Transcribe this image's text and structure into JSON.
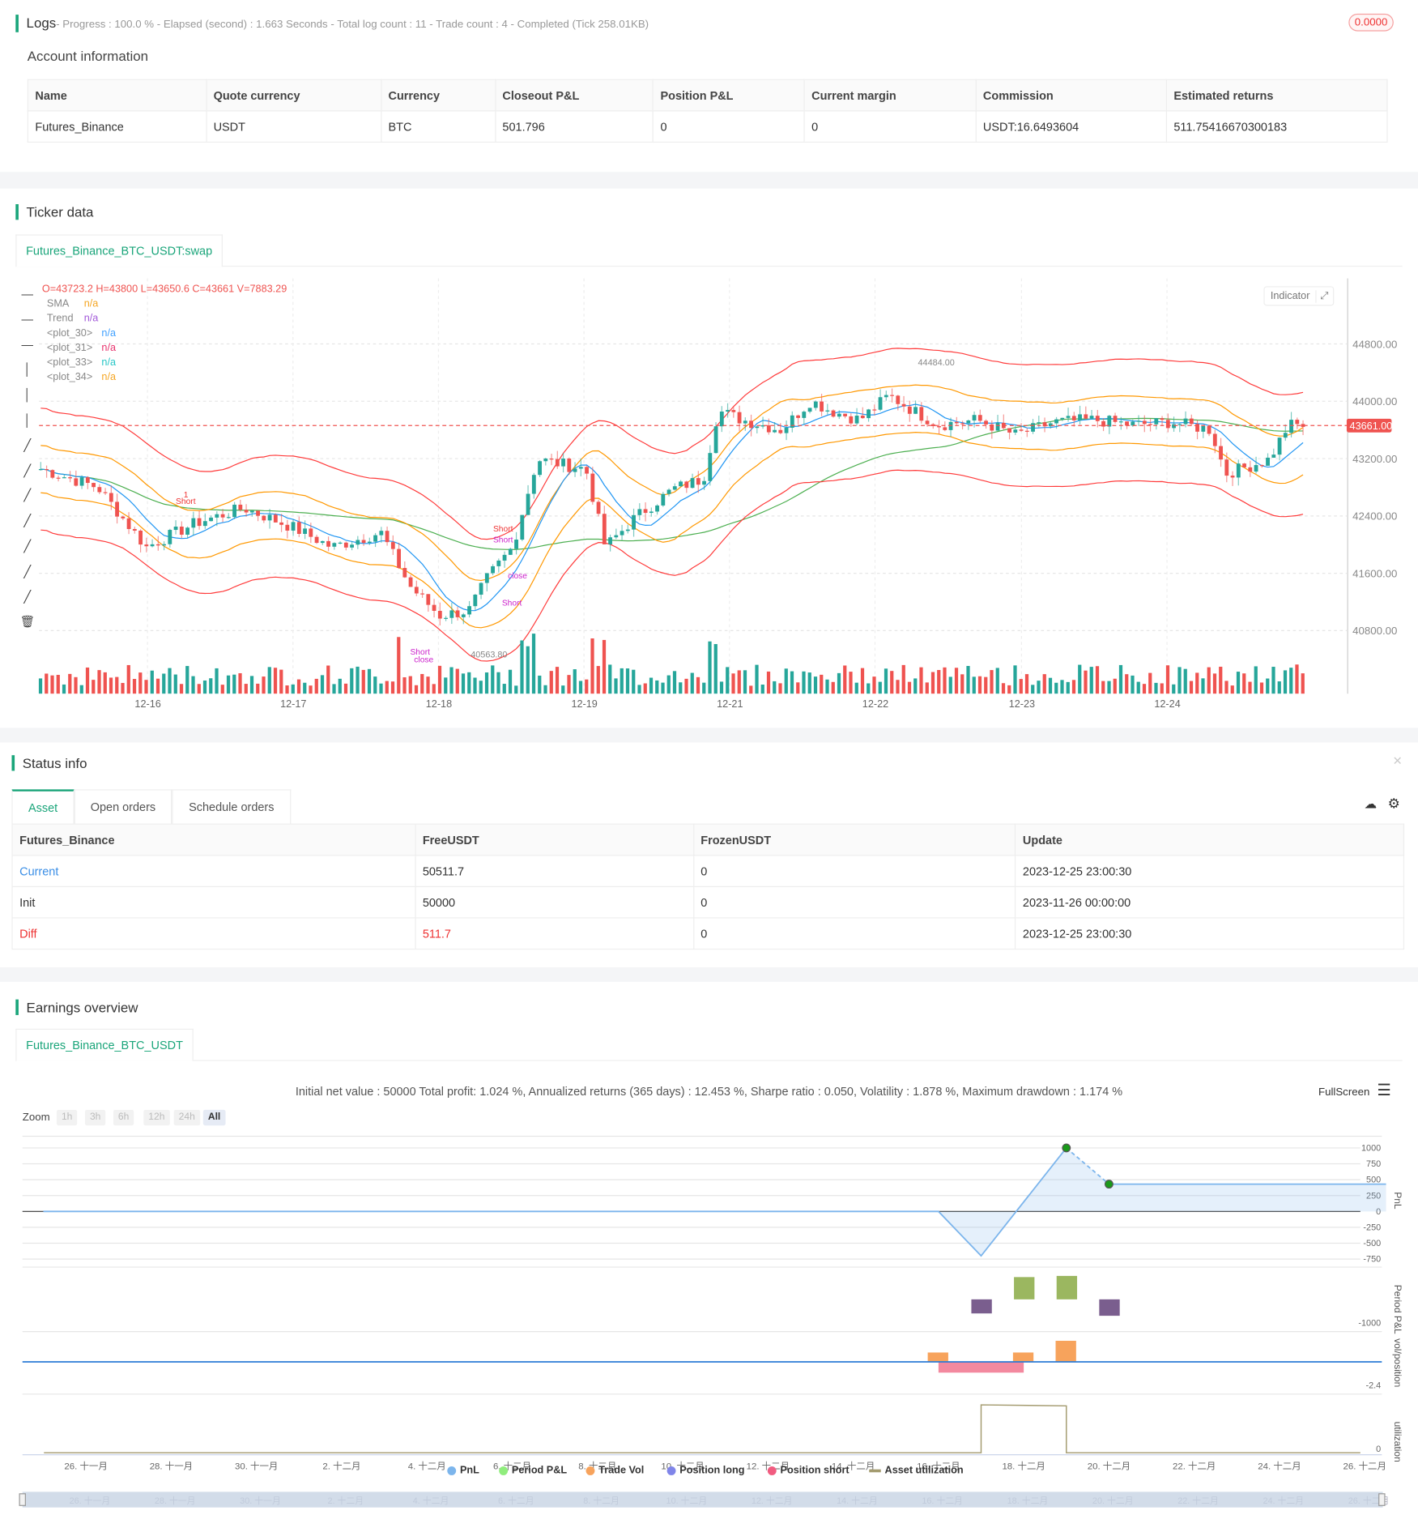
{
  "logs": {
    "title": "Logs",
    "summary": "- Progress : 100.0 % - Elapsed (second) : 1.663  Seconds - Total log count : 11 - Trade count : 4 - Completed (Tick 258.01KB)",
    "badge": "0.0000"
  },
  "account": {
    "title": "Account information",
    "headers": [
      "Name",
      "Quote currency",
      "Currency",
      "Closeout P&L",
      "Position P&L",
      "Current margin",
      "Commission",
      "Estimated returns"
    ],
    "row": [
      "Futures_Binance",
      "USDT",
      "BTC",
      "501.796",
      "0",
      "0",
      "USDT:16.6493604",
      "511.75416670300183"
    ]
  },
  "ticker": {
    "title": "Ticker data",
    "tab": "Futures_Binance_BTC_USDT:swap",
    "ohlc": "O=43723.2 H=43800 L=43650.6 C=43661 V=7883.29",
    "legend": [
      {
        "name": "SMA",
        "val": "n/a",
        "color": "#f5a623"
      },
      {
        "name": "Trend",
        "val": "n/a",
        "color": "#a259d9"
      },
      {
        "name": "<plot_30>",
        "val": "n/a",
        "color": "#3fa0ff"
      },
      {
        "name": "<plot_31>",
        "val": "n/a",
        "color": "#e8336d"
      },
      {
        "name": "<plot_33>",
        "val": "n/a",
        "color": "#26c6c6"
      },
      {
        "name": "<plot_34>",
        "val": "n/a",
        "color": "#f5a623"
      }
    ],
    "indicator_label": "Indicator",
    "last_price": "43661.00",
    "high_label": "44484.00",
    "low_label": "40563.80",
    "y_ticks": [
      "44800.00",
      "44000.00",
      "43200.00",
      "42400.00",
      "41600.00",
      "40800.00"
    ],
    "y_values": [
      44800,
      44000,
      43200,
      42400,
      41600,
      40800
    ],
    "x_ticks": [
      "12-16",
      "12-17",
      "12-18",
      "12-19",
      "12-21",
      "12-22",
      "12-23",
      "12-24"
    ],
    "markers": [
      "Short",
      "1",
      "Short",
      "close",
      "Short",
      "Short",
      "close",
      "Short"
    ],
    "price_anchors": [
      [
        6.4,
        43055
      ],
      [
        15.8,
        42800
      ],
      [
        23.8,
        41965
      ],
      [
        31.9,
        42300
      ],
      [
        39.9,
        42510
      ],
      [
        48,
        42240
      ],
      [
        54.4,
        41965
      ],
      [
        62.5,
        42170
      ],
      [
        67.3,
        41420
      ],
      [
        72.2,
        41010
      ],
      [
        77,
        41080
      ],
      [
        80.2,
        41555
      ],
      [
        84.2,
        41965
      ],
      [
        88.3,
        43190
      ],
      [
        96.3,
        43055
      ],
      [
        99.5,
        41965
      ],
      [
        104.4,
        42375
      ],
      [
        110.8,
        42780
      ],
      [
        115.7,
        42920
      ],
      [
        118.1,
        43870
      ],
      [
        122.1,
        43740
      ],
      [
        128.6,
        43600
      ],
      [
        133.4,
        44010
      ],
      [
        136.6,
        43870
      ],
      [
        141.5,
        43740
      ],
      [
        146.3,
        44080
      ],
      [
        150.3,
        43870
      ],
      [
        154.4,
        43670
      ],
      [
        160.8,
        43740
      ],
      [
        167.2,
        43530
      ],
      [
        173.6,
        43710
      ],
      [
        180.1,
        43740
      ],
      [
        186.5,
        43670
      ],
      [
        192.9,
        43710
      ],
      [
        199.4,
        43600
      ],
      [
        201.8,
        42990
      ],
      [
        204.2,
        43055
      ],
      [
        209,
        43190
      ],
      [
        212.2,
        43670
      ],
      [
        214.6,
        43661
      ]
    ]
  },
  "status": {
    "title": "Status info",
    "tabs": [
      "Asset",
      "Open orders",
      "Schedule orders"
    ],
    "headers": [
      "Futures_Binance",
      "FreeUSDT",
      "FrozenUSDT",
      "Update"
    ],
    "rows": [
      [
        "Current",
        "50511.7",
        "0",
        "2023-12-25 23:00:30"
      ],
      [
        "Init",
        "50000",
        "0",
        "2023-11-26 00:00:00"
      ],
      [
        "Diff",
        "511.7",
        "0",
        "2023-12-25 23:00:30"
      ]
    ]
  },
  "earnings": {
    "title": "Earnings overview",
    "tab": "Futures_Binance_BTC_USDT",
    "summary": "Initial net value : 50000 Total profit: 1.024 %, Annualized returns (365 days) : 12.453 %, Sharpe ratio : 0.050, Volatility : 1.878 %, Maximum drawdown : 1.174 %",
    "fullscreen": "FullScreen",
    "zoom_label": "Zoom",
    "zoom_options": [
      "1h",
      "3h",
      "6h",
      "12h",
      "24h",
      "All"
    ],
    "pnl_ticks": [
      "1000",
      "750",
      "500",
      "250",
      "0",
      "-250",
      "-500",
      "-750"
    ],
    "pnl_tick_values": [
      1000,
      750,
      500,
      250,
      0,
      -250,
      -500,
      -750
    ],
    "axis_titles": [
      "PnL",
      "Period P&L",
      "vol/position",
      "utilization"
    ],
    "period_tick": "-1000",
    "vol_tick": "-2.4",
    "util_tick": "0",
    "pnl_points": [
      [
        -1,
        0
      ],
      [
        20,
        0
      ],
      [
        21,
        -700
      ],
      [
        23,
        1000
      ],
      [
        24,
        430
      ],
      [
        30.5,
        430
      ]
    ],
    "period_pnl": [
      [
        21,
        -600
      ],
      [
        22,
        950
      ],
      [
        23,
        1000
      ],
      [
        24,
        -700
      ]
    ],
    "trade_vol": [
      [
        20,
        0.4
      ],
      [
        22,
        0.4
      ],
      [
        23,
        0.9
      ]
    ],
    "x_ticks": [
      "26. 十一月",
      "28. 十一月",
      "30. 十一月",
      "2. 十二月",
      "4. 十二月",
      "6. 十二月",
      "8. 十二月",
      "10. 十二月",
      "12. 十二月",
      "14. 十二月",
      "16. 十二月",
      "18. 十二月",
      "20. 十二月",
      "22. 十二月",
      "24. 十二月",
      "26. 十二月"
    ],
    "legend": [
      {
        "name": "PnL",
        "color": "#7cb5ec"
      },
      {
        "name": "Period P&L",
        "color": "#90ed7d"
      },
      {
        "name": "Trade Vol",
        "color": "#f7a35c"
      },
      {
        "name": "Position long",
        "color": "#8085e9"
      },
      {
        "name": "Position short",
        "color": "#f15c80"
      },
      {
        "name": "Asset utilization",
        "color": "#a39a6e"
      }
    ]
  },
  "colors": {
    "accent": "#1aa57a",
    "up": "#26a69a",
    "down": "#ef5350"
  }
}
